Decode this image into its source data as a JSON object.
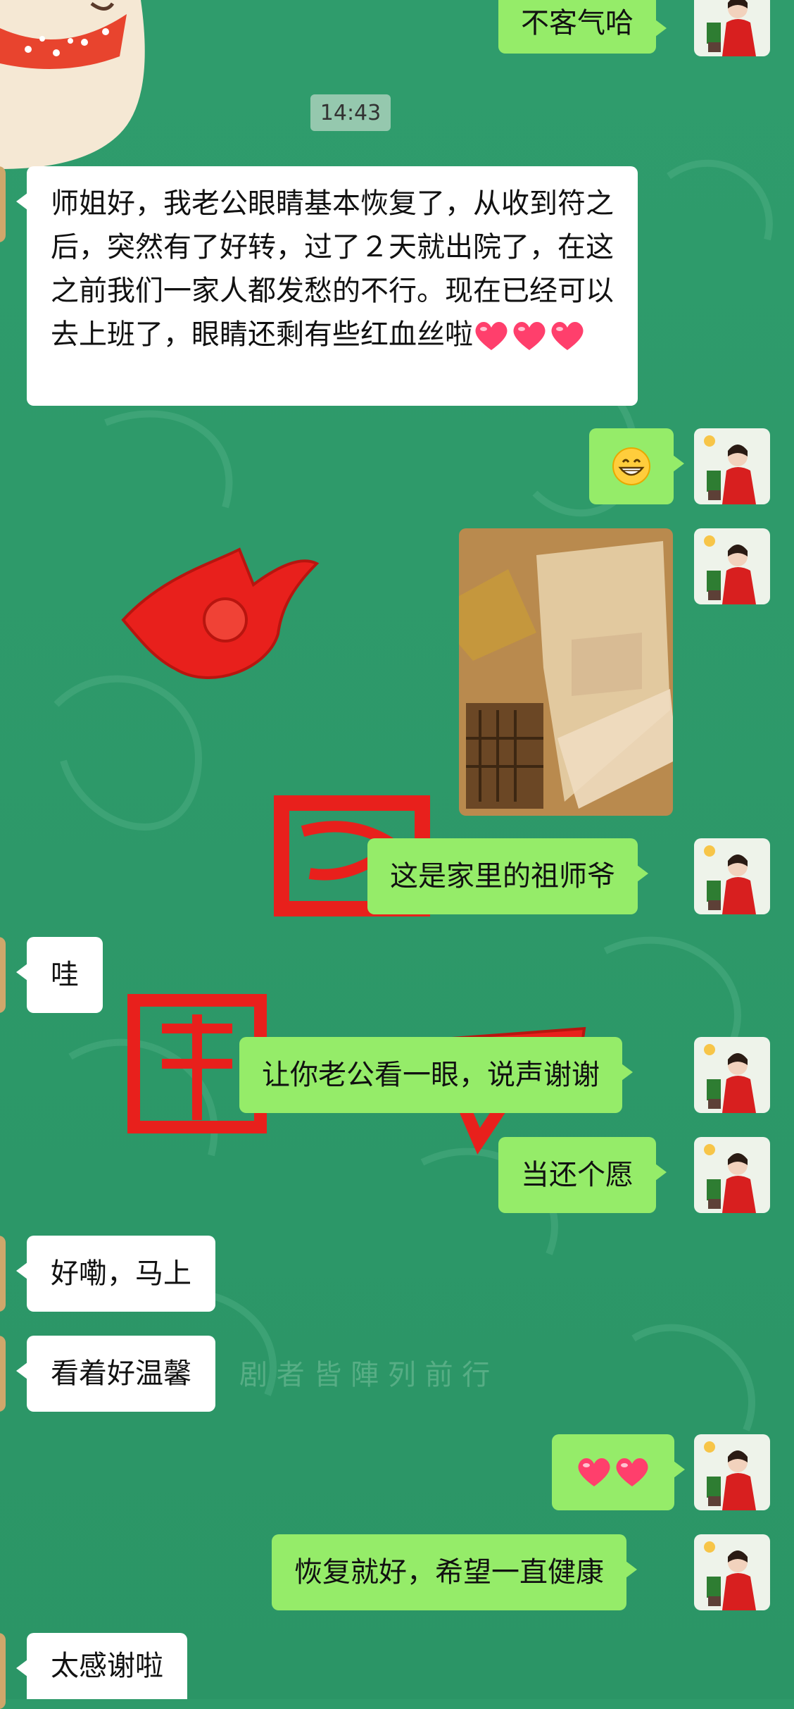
{
  "timestamp": "14:43",
  "messages": {
    "m1": "不客气哈",
    "m2": "师姐好，我老公眼睛基本恢复了，从收到符之后，突然有了好转，过了２天就出院了，在这之前我们一家人都发愁的不行。现在已经可以去上班了，眼睛还剩有些红血丝啦",
    "m4": "这是家里的祖师爷",
    "m5": "哇",
    "m6": "让你老公看一眼，说声谢谢",
    "m7": "当还个愿",
    "m8": "好嘞，马上",
    "m9": "看着好温馨",
    "m11": "恢复就好，希望一直健康",
    "m12": "太感谢啦"
  },
  "wallpaper_text": "剧 者 皆 陣 列 前 行",
  "icons": {
    "heart": "heart-emoji-icon",
    "grin": "grinning-emoji-icon"
  },
  "colors": {
    "outgoing_bubble": "#95ec69",
    "incoming_bubble": "#ffffff",
    "wallpaper": "#2e9a6a",
    "heart": "#ff3f6c"
  }
}
